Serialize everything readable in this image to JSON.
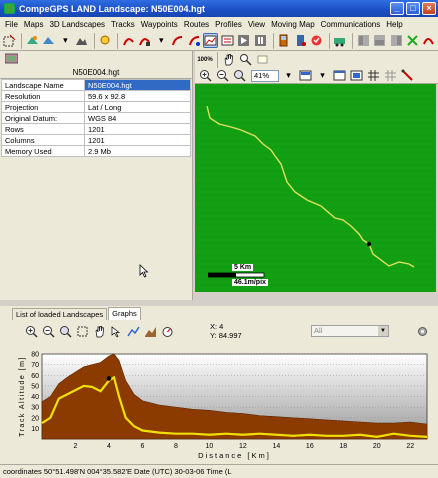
{
  "window": {
    "title": "CompeGPS LAND Landscape: N50E004.hgt"
  },
  "menu": [
    "File",
    "Maps",
    "3D Landscapes",
    "Tracks",
    "Waypoints",
    "Routes",
    "Profiles",
    "View",
    "Moving Map",
    "Communications",
    "Help"
  ],
  "panel": {
    "file_title": "N50E004.hgt",
    "properties": [
      {
        "key": "Landscape Name",
        "value": "N50E004.hgt"
      },
      {
        "key": "Resolution",
        "value": "59.6 x 92.8"
      },
      {
        "key": "Projection",
        "value": "Lat / Long"
      },
      {
        "key": "Original Datum:",
        "value": "WGS 84"
      },
      {
        "key": "Rows",
        "value": "1201"
      },
      {
        "key": "Columns",
        "value": "1201"
      },
      {
        "key": "Memory Used",
        "value": "2.9 Mb"
      }
    ]
  },
  "map": {
    "zoom_button": "100%",
    "zoom_level": "41%",
    "scale_top": "5 Km",
    "scale_bottom": "46.1m/pix",
    "track_color": "#e0e060",
    "terrain_color": "#12a012"
  },
  "tabs": {
    "loaded": "List of loaded Landscapes",
    "graphs": "Graphs"
  },
  "graph": {
    "coord_x": "X: 4",
    "coord_y": "Y: 84.997",
    "series_select": "All",
    "ylabel": "Track Altitude [m]",
    "xlabel": "Distance [Km]"
  },
  "chart_data": {
    "type": "area",
    "xlabel": "Distance [Km]",
    "ylabel": "Track Altitude [m]",
    "xlim": [
      0,
      23
    ],
    "ylim": [
      0,
      80
    ],
    "x_ticks": [
      2,
      4,
      6,
      8,
      10,
      12,
      14,
      16,
      18,
      20,
      22
    ],
    "y_ticks": [
      10,
      20,
      30,
      40,
      50,
      60,
      70,
      80
    ],
    "series": [
      {
        "color": "#8b3a00",
        "x": [
          0,
          0.5,
          1,
          1.5,
          2,
          2.5,
          3,
          3.5,
          4,
          4.3,
          4.6,
          5,
          5.5,
          6,
          7,
          8,
          9,
          10,
          11,
          12,
          13,
          14,
          15,
          16,
          17,
          18,
          19,
          20,
          21,
          22,
          23
        ],
        "values": [
          35,
          40,
          52,
          58,
          63,
          68,
          70,
          72,
          78,
          80,
          74,
          55,
          42,
          36,
          32,
          30,
          28,
          27,
          25,
          24,
          22,
          21,
          20,
          19,
          18,
          17,
          16,
          15,
          15,
          16,
          14
        ]
      },
      {
        "color": "#f0e000",
        "x": [
          0,
          0.5,
          1,
          1.5,
          2,
          2.5,
          3,
          3.5,
          4,
          4.3,
          4.6,
          5,
          5.5,
          6,
          7,
          8,
          9,
          10,
          11,
          12,
          13,
          14,
          15,
          16,
          17,
          18,
          19,
          20,
          21,
          22,
          23
        ],
        "values": [
          15,
          20,
          38,
          42,
          46,
          50,
          49,
          45,
          55,
          58,
          40,
          20,
          12,
          8,
          6,
          5,
          5,
          4,
          5,
          4,
          5,
          4,
          3,
          4,
          3,
          3,
          4,
          2,
          5,
          3,
          2
        ]
      }
    ],
    "marker": {
      "x": 4,
      "y": 57
    }
  },
  "status": {
    "text": "coordinates 50°51.498'N 004°35.582'E Date (UTC) 30-03-06 Time (L"
  }
}
